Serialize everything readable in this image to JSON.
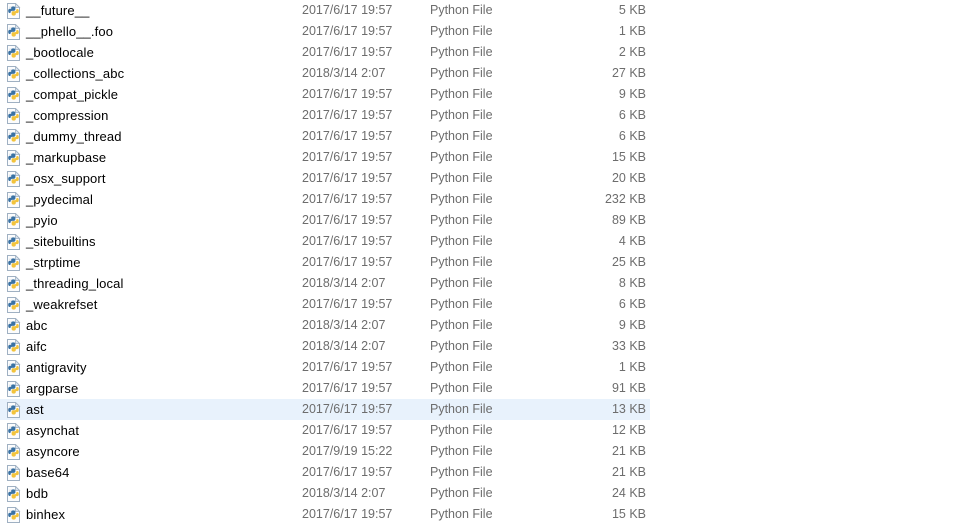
{
  "window": {
    "view_mode": "details-list",
    "background_color": "#ffffff",
    "selection_color": "#e8f2fc",
    "name_text_color": "#000000",
    "meta_text_color": "#6d6d6d"
  },
  "columns": [
    {
      "key": "name",
      "align": "left"
    },
    {
      "key": "date_modified",
      "align": "left"
    },
    {
      "key": "type",
      "align": "left"
    },
    {
      "key": "size",
      "align": "right"
    }
  ],
  "files": [
    {
      "icon": "python-file-icon",
      "name": "__future__",
      "date_modified": "2017/6/17 19:57",
      "type": "Python File",
      "size": "5 KB",
      "selected": false
    },
    {
      "icon": "python-file-icon",
      "name": "__phello__.foo",
      "date_modified": "2017/6/17 19:57",
      "type": "Python File",
      "size": "1 KB",
      "selected": false
    },
    {
      "icon": "python-file-icon",
      "name": "_bootlocale",
      "date_modified": "2017/6/17 19:57",
      "type": "Python File",
      "size": "2 KB",
      "selected": false
    },
    {
      "icon": "python-file-icon",
      "name": "_collections_abc",
      "date_modified": "2018/3/14 2:07",
      "type": "Python File",
      "size": "27 KB",
      "selected": false
    },
    {
      "icon": "python-file-icon",
      "name": "_compat_pickle",
      "date_modified": "2017/6/17 19:57",
      "type": "Python File",
      "size": "9 KB",
      "selected": false
    },
    {
      "icon": "python-file-icon",
      "name": "_compression",
      "date_modified": "2017/6/17 19:57",
      "type": "Python File",
      "size": "6 KB",
      "selected": false
    },
    {
      "icon": "python-file-icon",
      "name": "_dummy_thread",
      "date_modified": "2017/6/17 19:57",
      "type": "Python File",
      "size": "6 KB",
      "selected": false
    },
    {
      "icon": "python-file-icon",
      "name": "_markupbase",
      "date_modified": "2017/6/17 19:57",
      "type": "Python File",
      "size": "15 KB",
      "selected": false
    },
    {
      "icon": "python-file-icon",
      "name": "_osx_support",
      "date_modified": "2017/6/17 19:57",
      "type": "Python File",
      "size": "20 KB",
      "selected": false
    },
    {
      "icon": "python-file-icon",
      "name": "_pydecimal",
      "date_modified": "2017/6/17 19:57",
      "type": "Python File",
      "size": "232 KB",
      "selected": false
    },
    {
      "icon": "python-file-icon",
      "name": "_pyio",
      "date_modified": "2017/6/17 19:57",
      "type": "Python File",
      "size": "89 KB",
      "selected": false
    },
    {
      "icon": "python-file-icon",
      "name": "_sitebuiltins",
      "date_modified": "2017/6/17 19:57",
      "type": "Python File",
      "size": "4 KB",
      "selected": false
    },
    {
      "icon": "python-file-icon",
      "name": "_strptime",
      "date_modified": "2017/6/17 19:57",
      "type": "Python File",
      "size": "25 KB",
      "selected": false
    },
    {
      "icon": "python-file-icon",
      "name": "_threading_local",
      "date_modified": "2018/3/14 2:07",
      "type": "Python File",
      "size": "8 KB",
      "selected": false
    },
    {
      "icon": "python-file-icon",
      "name": "_weakrefset",
      "date_modified": "2017/6/17 19:57",
      "type": "Python File",
      "size": "6 KB",
      "selected": false
    },
    {
      "icon": "python-file-icon",
      "name": "abc",
      "date_modified": "2018/3/14 2:07",
      "type": "Python File",
      "size": "9 KB",
      "selected": false
    },
    {
      "icon": "python-file-icon",
      "name": "aifc",
      "date_modified": "2018/3/14 2:07",
      "type": "Python File",
      "size": "33 KB",
      "selected": false
    },
    {
      "icon": "python-file-icon",
      "name": "antigravity",
      "date_modified": "2017/6/17 19:57",
      "type": "Python File",
      "size": "1 KB",
      "selected": false
    },
    {
      "icon": "python-file-icon",
      "name": "argparse",
      "date_modified": "2017/6/17 19:57",
      "type": "Python File",
      "size": "91 KB",
      "selected": false
    },
    {
      "icon": "python-file-icon",
      "name": "ast",
      "date_modified": "2017/6/17 19:57",
      "type": "Python File",
      "size": "13 KB",
      "selected": true
    },
    {
      "icon": "python-file-icon",
      "name": "asynchat",
      "date_modified": "2017/6/17 19:57",
      "type": "Python File",
      "size": "12 KB",
      "selected": false
    },
    {
      "icon": "python-file-icon",
      "name": "asyncore",
      "date_modified": "2017/9/19 15:22",
      "type": "Python File",
      "size": "21 KB",
      "selected": false
    },
    {
      "icon": "python-file-icon",
      "name": "base64",
      "date_modified": "2017/6/17 19:57",
      "type": "Python File",
      "size": "21 KB",
      "selected": false
    },
    {
      "icon": "python-file-icon",
      "name": "bdb",
      "date_modified": "2018/3/14 2:07",
      "type": "Python File",
      "size": "24 KB",
      "selected": false
    },
    {
      "icon": "python-file-icon",
      "name": "binhex",
      "date_modified": "2017/6/17 19:57",
      "type": "Python File",
      "size": "15 KB",
      "selected": false
    }
  ]
}
